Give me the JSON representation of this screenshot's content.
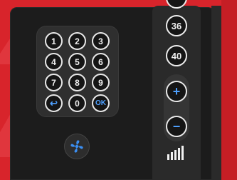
{
  "keypad": {
    "keys": [
      "1",
      "2",
      "3",
      "4",
      "5",
      "6",
      "7",
      "8",
      "9",
      "↩",
      "0",
      "OK"
    ]
  },
  "fan": {
    "icon": "fan-icon"
  },
  "channels": {
    "items": [
      "36",
      "40"
    ]
  },
  "volume": {
    "up_label": "+",
    "down_label": "−"
  },
  "signal": {
    "icon": "signal-bars-icon"
  },
  "colors": {
    "background": "#d8242b",
    "panel": "#1c1c1c",
    "accent_blue": "#4ea0ff",
    "button_ring": "#e8e8e8"
  }
}
